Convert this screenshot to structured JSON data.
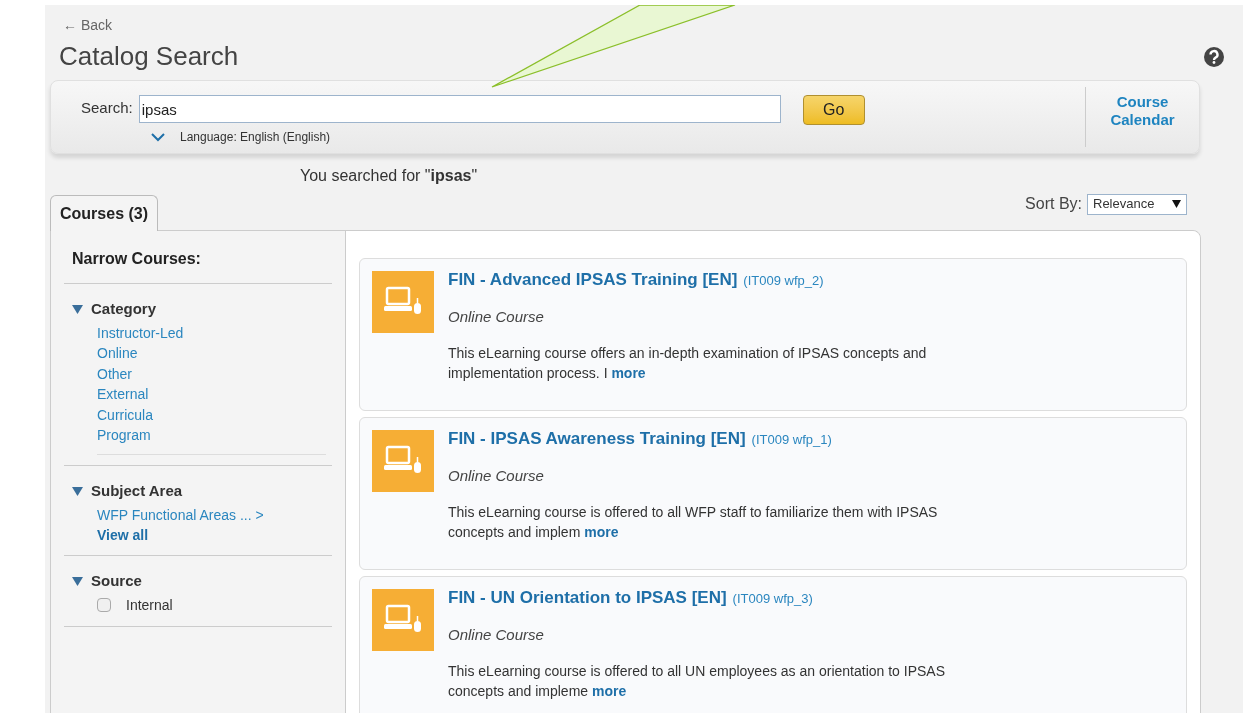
{
  "back_link": "← Back",
  "page_title": "Catalog Search",
  "search": {
    "label": "Search:",
    "value": "ipsas",
    "button": "Go",
    "language": "Language: English (English)",
    "calendar_link": "Course Calendar"
  },
  "searched_for": "You searched for \"**ipsas**\"",
  "tabs": [
    {
      "label": "Courses (3)",
      "selected": true
    }
  ],
  "sort": {
    "label": "Sort By:",
    "value": "Relevance"
  },
  "narrow": {
    "title": "Narrow Courses:",
    "facets": [
      {
        "kind": "links",
        "title": "Category",
        "expanded": true,
        "items": [
          "Instructor-Led",
          "Online",
          "Other",
          "External",
          "Curricula",
          "Program"
        ]
      },
      {
        "kind": "subject",
        "title": "Subject Area",
        "expanded": true,
        "items": [
          "WFP Functional Areas ... >"
        ],
        "view_all": "View all"
      },
      {
        "kind": "checkboxes",
        "title": "Source",
        "expanded": true,
        "options": [
          {
            "label": "Internal",
            "checked": false
          }
        ]
      }
    ]
  },
  "courses": [
    {
      "title": "FIN - Advanced IPSAS Training [EN]",
      "code": "(IT009 wfp_2)",
      "type": "Online Course",
      "description": "This eLearning course offers an in-depth examination of IPSAS concepts and implementation process. I",
      "more": "more"
    },
    {
      "title": "FIN - IPSAS Awareness Training [EN]",
      "code": "(IT009 wfp_1)",
      "type": "Online Course",
      "description": "This eLearning course is offered to all WFP staff to familiarize them with IPSAS concepts and implem",
      "more": "more"
    },
    {
      "title": "FIN - UN Orientation to IPSAS [EN]",
      "code": "(IT009 wfp_3)",
      "type": "Online Course",
      "description": "This eLearning course is offered to all UN employees as an orientation to IPSAS concepts and impleme",
      "more": "more"
    }
  ]
}
